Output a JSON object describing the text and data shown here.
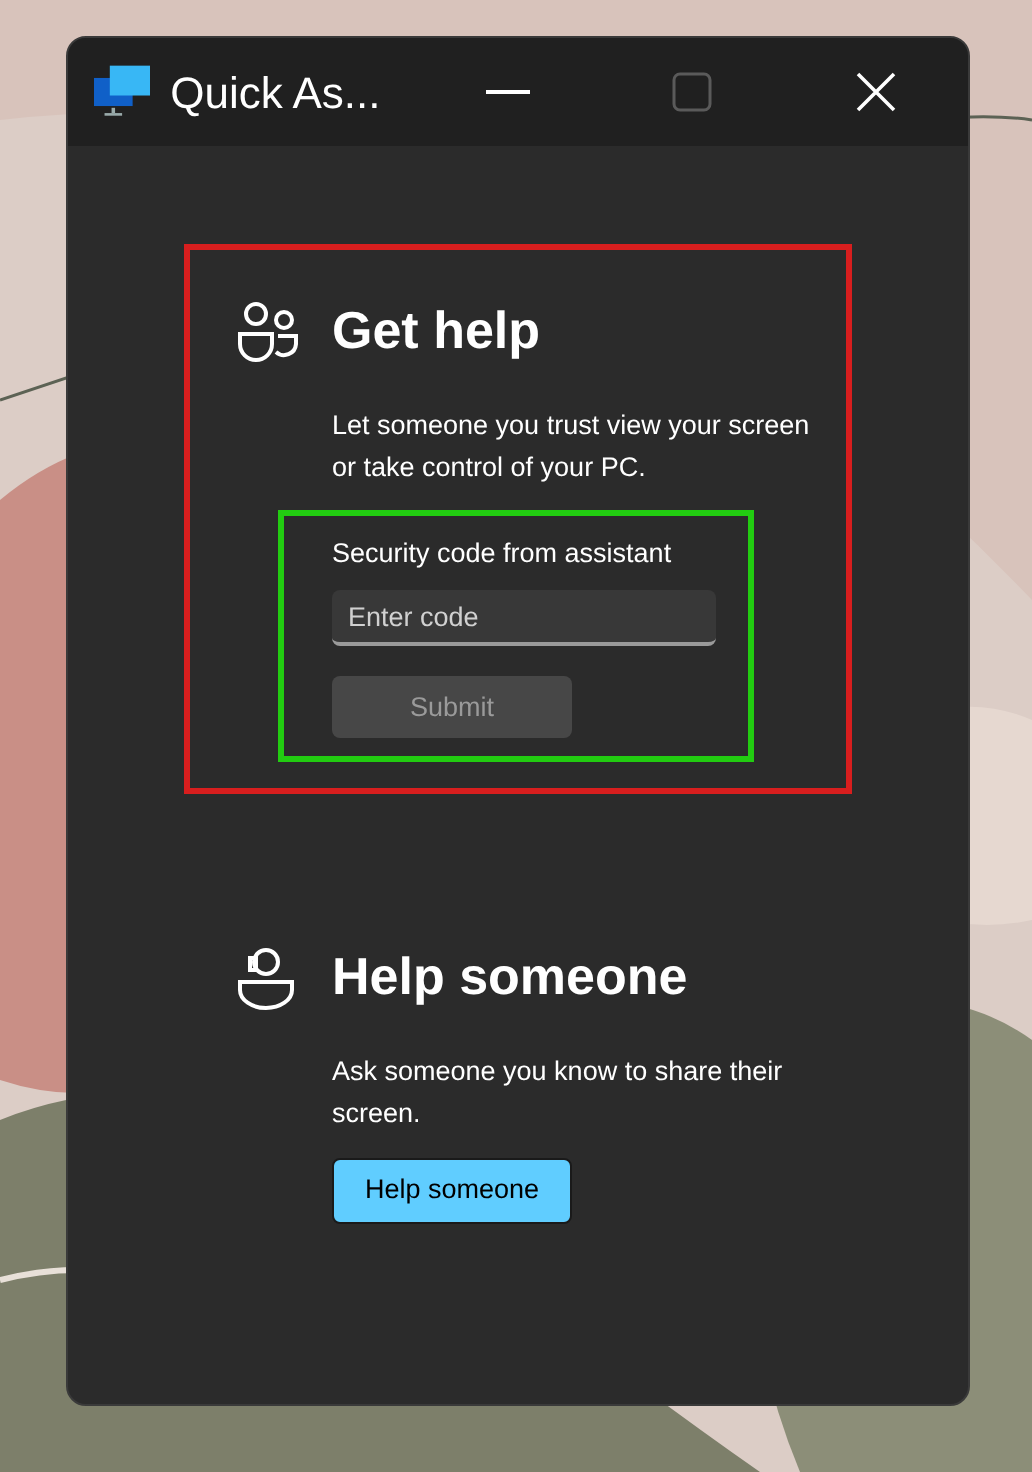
{
  "window": {
    "title": "Quick As...",
    "controls": [
      {
        "kind": "minimize",
        "disabled": false
      },
      {
        "kind": "maximize",
        "disabled": true
      },
      {
        "kind": "close",
        "disabled": false
      }
    ]
  },
  "get_help": {
    "title": "Get help",
    "description": "Let someone you trust view your screen or take control of your PC.",
    "field_label": "Security code from assistant",
    "code_field": {
      "placeholder": "Enter code"
    },
    "submit_button": {
      "label": "Submit",
      "disabled": true
    }
  },
  "help_someone": {
    "title": "Help someone",
    "description": "Ask someone you know to share their screen.",
    "button": {
      "label": "Help someone"
    }
  }
}
